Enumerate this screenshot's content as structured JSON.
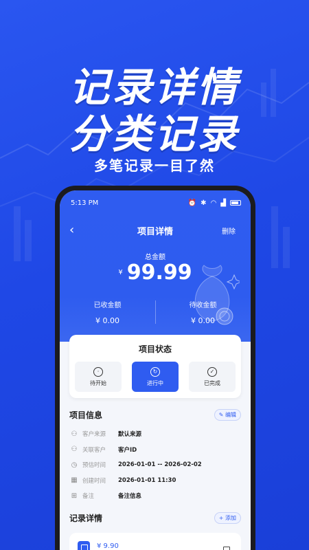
{
  "promo": {
    "headline_1": "记录详情",
    "headline_2": "分类记录",
    "subline": "多笔记录一目了然"
  },
  "status_bar": {
    "time": "5:13 PM"
  },
  "nav": {
    "back_icon": "chevron-left-icon",
    "title": "项目详情",
    "delete_label": "删除"
  },
  "summary": {
    "total_label": "总金额",
    "currency": "¥",
    "total_amount": "99.99",
    "received_label": "已收金额",
    "received_value": "¥ 0.00",
    "pending_label": "待收金额",
    "pending_value": "¥ 0.00"
  },
  "project_status": {
    "title": "项目状态",
    "options": [
      {
        "label": "待开始",
        "icon": "clock-icon",
        "active": false
      },
      {
        "label": "进行中",
        "icon": "progress-icon",
        "active": true
      },
      {
        "label": "已完成",
        "icon": "check-circle-icon",
        "active": false
      }
    ]
  },
  "project_info": {
    "title": "项目信息",
    "edit_label": "编辑",
    "rows": [
      {
        "icon": "person-icon",
        "key": "客户来源",
        "value": "默认来源"
      },
      {
        "icon": "person-icon",
        "key": "关联客户",
        "value": "客户ID"
      },
      {
        "icon": "clock-icon",
        "key": "预估时间",
        "value": "2026-01-01 -- 2026-02-02"
      },
      {
        "icon": "calendar-icon",
        "key": "创建时间",
        "value": "2026-01-01 11:30"
      },
      {
        "icon": "grid-icon",
        "key": "备注",
        "value": "备注信息"
      }
    ]
  },
  "records": {
    "title": "记录详情",
    "add_label": "+ 添加",
    "items": [
      {
        "amount": "¥ 9.90"
      }
    ]
  },
  "colors": {
    "primary": "#2f5cf0",
    "background": "#1f48e6"
  }
}
